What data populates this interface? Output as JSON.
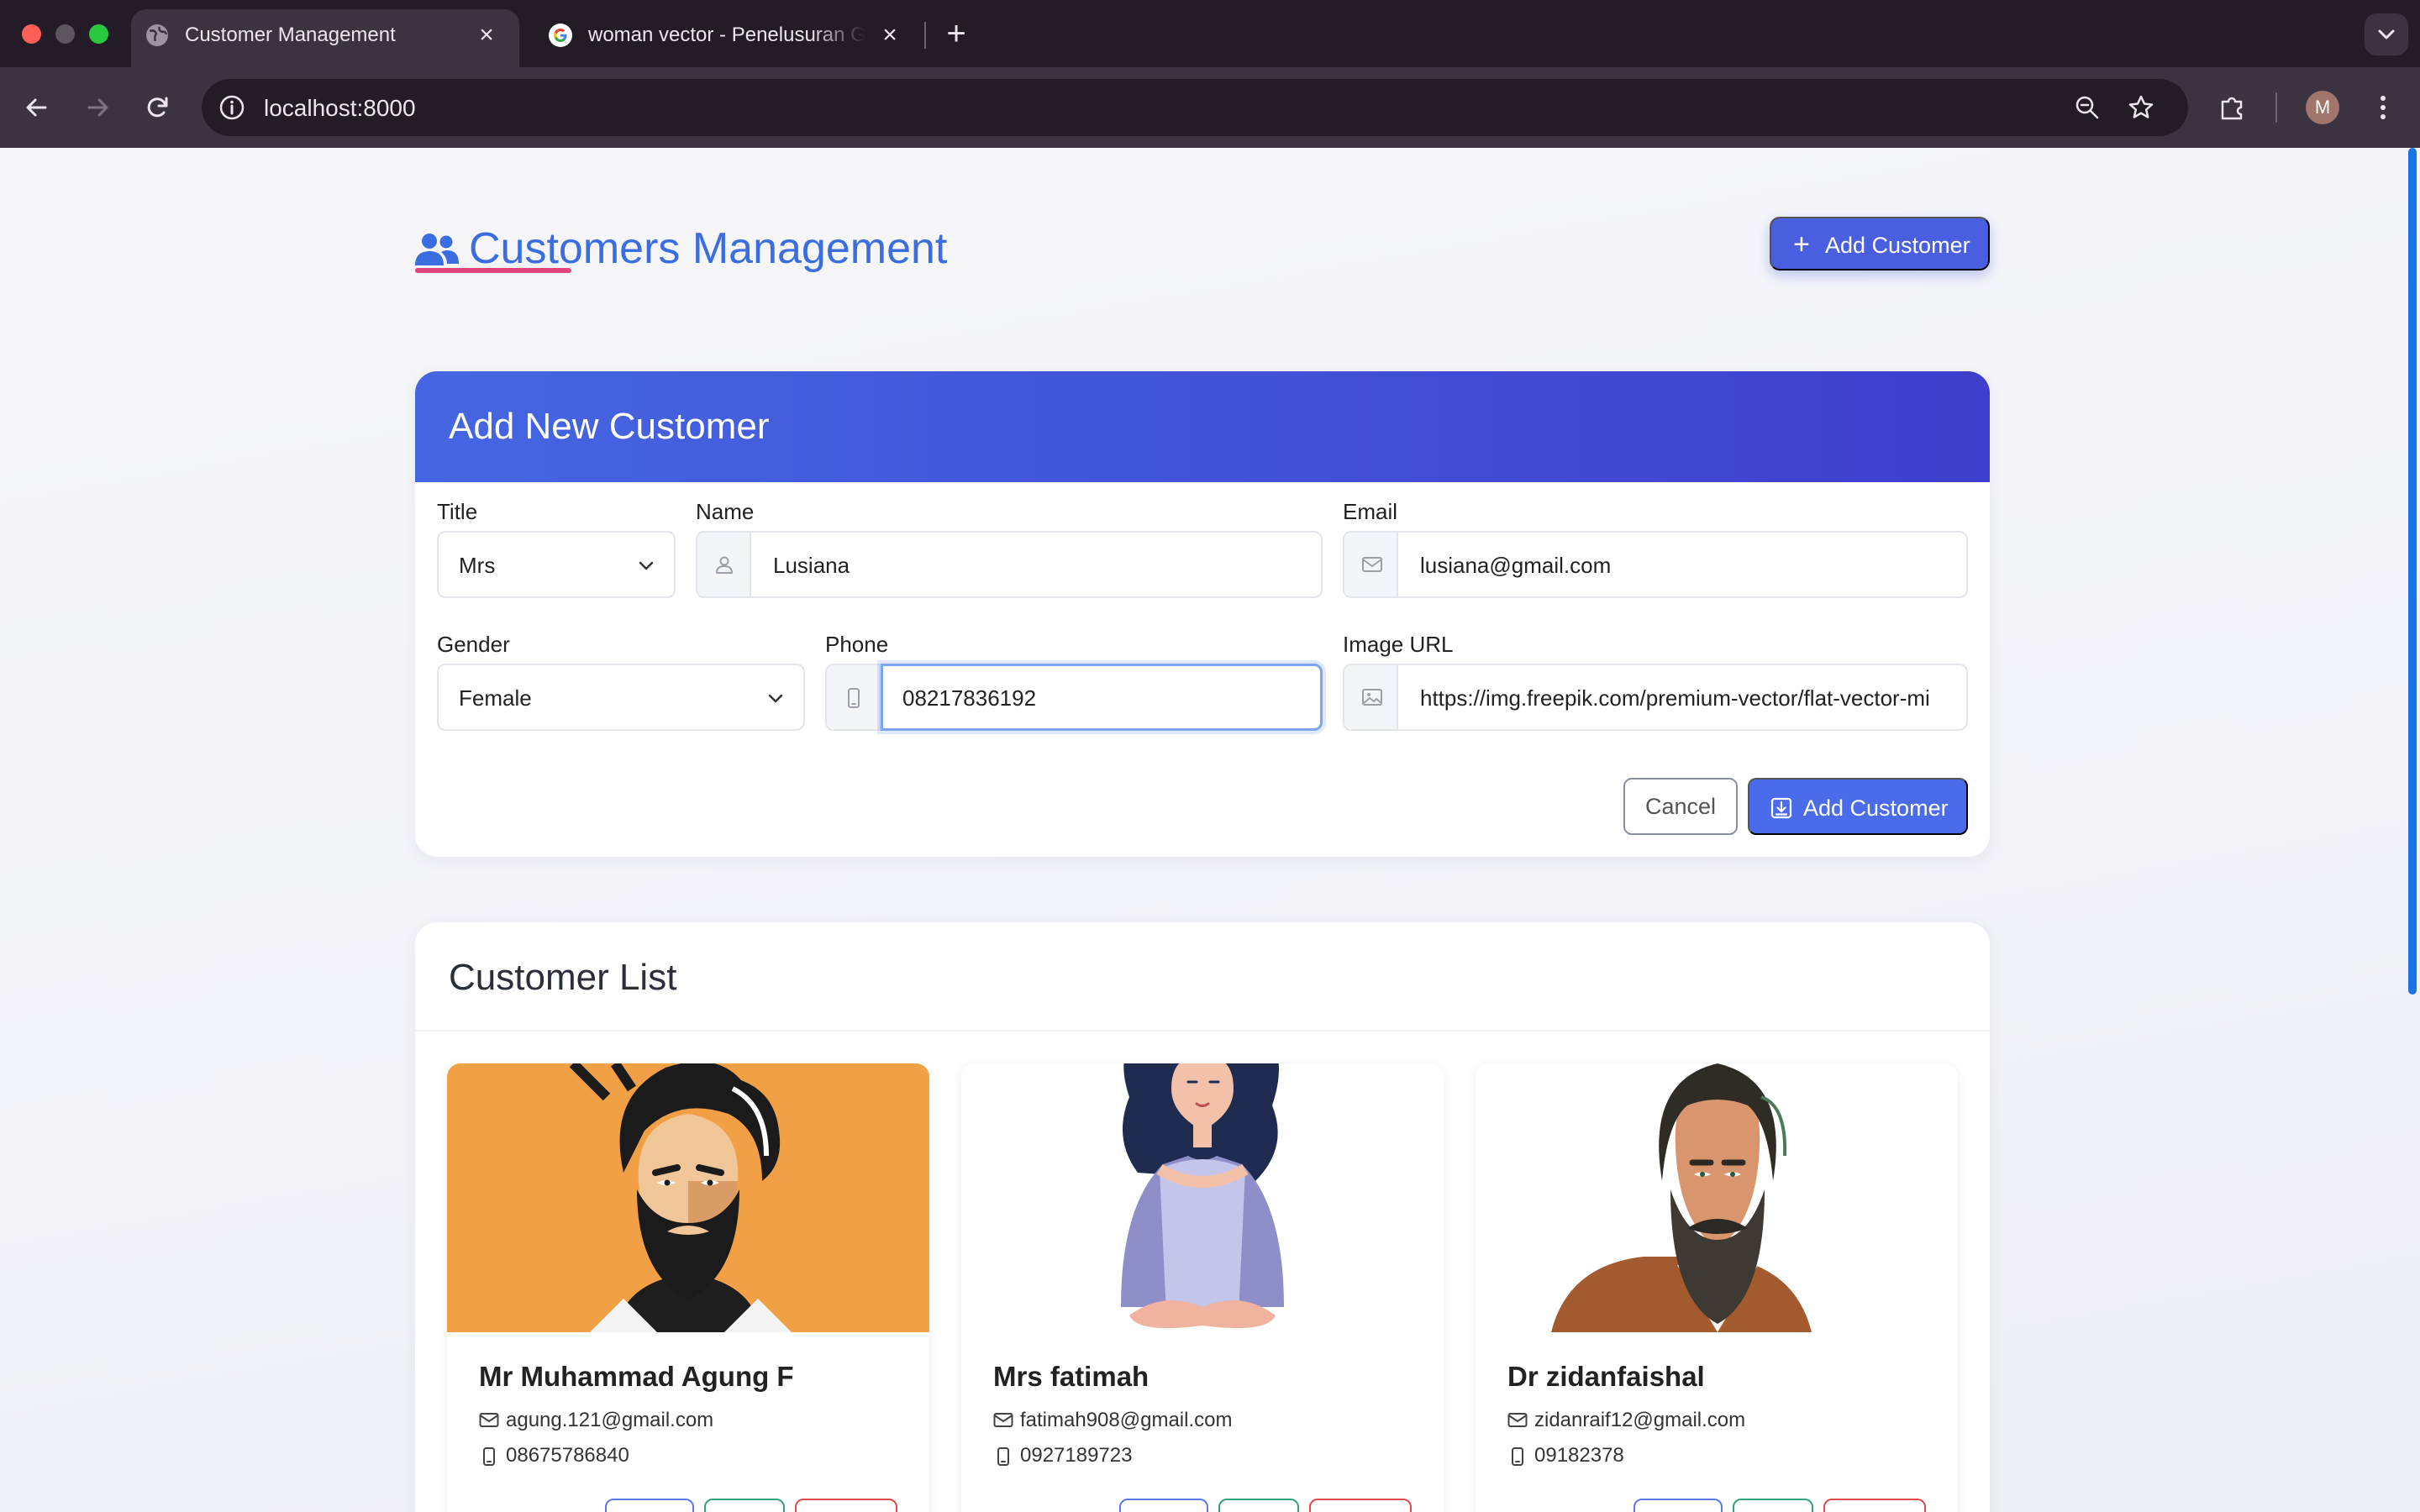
{
  "browser": {
    "tabs": [
      {
        "title": "Customer Management",
        "active": true,
        "icon": "globe-icon"
      },
      {
        "title": "woman vector - Penelusuran Google",
        "active": false,
        "icon": "google-icon"
      }
    ],
    "url": "localhost:8000",
    "profile_initial": "M"
  },
  "page": {
    "title": "Customers Management",
    "header_button": "Add Customer",
    "accent_color": "#4a5fe0",
    "underline_color": "#e0457b"
  },
  "form": {
    "heading": "Add New Customer",
    "title_label": "Title",
    "title_value": "Mrs",
    "name_label": "Name",
    "name_value": "Lusiana",
    "email_label": "Email",
    "email_value": "lusiana@gmail.com",
    "gender_label": "Gender",
    "gender_value": "Female",
    "phone_label": "Phone",
    "phone_value": "08217836192",
    "image_label": "Image URL",
    "image_value": "https://img.freepik.com/premium-vector/flat-vector-mi",
    "cancel_label": "Cancel",
    "submit_label": "Add Customer"
  },
  "list": {
    "heading": "Customer List",
    "customers": [
      {
        "name": "Mr Muhammad Agung F",
        "email": "agung.121@gmail.com",
        "phone": "08675786840"
      },
      {
        "name": "Mrs fatimah",
        "email": "fatimah908@gmail.com",
        "phone": "0927189723"
      },
      {
        "name": "Dr zidanfaishal",
        "email": "zidanraif12@gmail.com",
        "phone": "09182378"
      }
    ]
  }
}
